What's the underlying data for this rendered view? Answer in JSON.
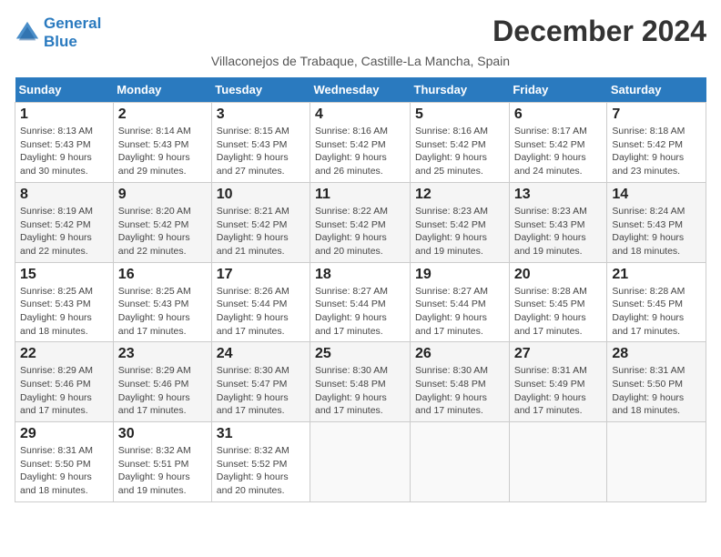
{
  "logo": {
    "line1": "General",
    "line2": "Blue"
  },
  "title": "December 2024",
  "subtitle": "Villaconejos de Trabaque, Castille-La Mancha, Spain",
  "days_of_week": [
    "Sunday",
    "Monday",
    "Tuesday",
    "Wednesday",
    "Thursday",
    "Friday",
    "Saturday"
  ],
  "weeks": [
    [
      {
        "day": "1",
        "detail": "Sunrise: 8:13 AM\nSunset: 5:43 PM\nDaylight: 9 hours\nand 30 minutes."
      },
      {
        "day": "2",
        "detail": "Sunrise: 8:14 AM\nSunset: 5:43 PM\nDaylight: 9 hours\nand 29 minutes."
      },
      {
        "day": "3",
        "detail": "Sunrise: 8:15 AM\nSunset: 5:43 PM\nDaylight: 9 hours\nand 27 minutes."
      },
      {
        "day": "4",
        "detail": "Sunrise: 8:16 AM\nSunset: 5:42 PM\nDaylight: 9 hours\nand 26 minutes."
      },
      {
        "day": "5",
        "detail": "Sunrise: 8:16 AM\nSunset: 5:42 PM\nDaylight: 9 hours\nand 25 minutes."
      },
      {
        "day": "6",
        "detail": "Sunrise: 8:17 AM\nSunset: 5:42 PM\nDaylight: 9 hours\nand 24 minutes."
      },
      {
        "day": "7",
        "detail": "Sunrise: 8:18 AM\nSunset: 5:42 PM\nDaylight: 9 hours\nand 23 minutes."
      }
    ],
    [
      {
        "day": "8",
        "detail": "Sunrise: 8:19 AM\nSunset: 5:42 PM\nDaylight: 9 hours\nand 22 minutes."
      },
      {
        "day": "9",
        "detail": "Sunrise: 8:20 AM\nSunset: 5:42 PM\nDaylight: 9 hours\nand 22 minutes."
      },
      {
        "day": "10",
        "detail": "Sunrise: 8:21 AM\nSunset: 5:42 PM\nDaylight: 9 hours\nand 21 minutes."
      },
      {
        "day": "11",
        "detail": "Sunrise: 8:22 AM\nSunset: 5:42 PM\nDaylight: 9 hours\nand 20 minutes."
      },
      {
        "day": "12",
        "detail": "Sunrise: 8:23 AM\nSunset: 5:42 PM\nDaylight: 9 hours\nand 19 minutes."
      },
      {
        "day": "13",
        "detail": "Sunrise: 8:23 AM\nSunset: 5:43 PM\nDaylight: 9 hours\nand 19 minutes."
      },
      {
        "day": "14",
        "detail": "Sunrise: 8:24 AM\nSunset: 5:43 PM\nDaylight: 9 hours\nand 18 minutes."
      }
    ],
    [
      {
        "day": "15",
        "detail": "Sunrise: 8:25 AM\nSunset: 5:43 PM\nDaylight: 9 hours\nand 18 minutes."
      },
      {
        "day": "16",
        "detail": "Sunrise: 8:25 AM\nSunset: 5:43 PM\nDaylight: 9 hours\nand 17 minutes."
      },
      {
        "day": "17",
        "detail": "Sunrise: 8:26 AM\nSunset: 5:44 PM\nDaylight: 9 hours\nand 17 minutes."
      },
      {
        "day": "18",
        "detail": "Sunrise: 8:27 AM\nSunset: 5:44 PM\nDaylight: 9 hours\nand 17 minutes."
      },
      {
        "day": "19",
        "detail": "Sunrise: 8:27 AM\nSunset: 5:44 PM\nDaylight: 9 hours\nand 17 minutes."
      },
      {
        "day": "20",
        "detail": "Sunrise: 8:28 AM\nSunset: 5:45 PM\nDaylight: 9 hours\nand 17 minutes."
      },
      {
        "day": "21",
        "detail": "Sunrise: 8:28 AM\nSunset: 5:45 PM\nDaylight: 9 hours\nand 17 minutes."
      }
    ],
    [
      {
        "day": "22",
        "detail": "Sunrise: 8:29 AM\nSunset: 5:46 PM\nDaylight: 9 hours\nand 17 minutes."
      },
      {
        "day": "23",
        "detail": "Sunrise: 8:29 AM\nSunset: 5:46 PM\nDaylight: 9 hours\nand 17 minutes."
      },
      {
        "day": "24",
        "detail": "Sunrise: 8:30 AM\nSunset: 5:47 PM\nDaylight: 9 hours\nand 17 minutes."
      },
      {
        "day": "25",
        "detail": "Sunrise: 8:30 AM\nSunset: 5:48 PM\nDaylight: 9 hours\nand 17 minutes."
      },
      {
        "day": "26",
        "detail": "Sunrise: 8:30 AM\nSunset: 5:48 PM\nDaylight: 9 hours\nand 17 minutes."
      },
      {
        "day": "27",
        "detail": "Sunrise: 8:31 AM\nSunset: 5:49 PM\nDaylight: 9 hours\nand 17 minutes."
      },
      {
        "day": "28",
        "detail": "Sunrise: 8:31 AM\nSunset: 5:50 PM\nDaylight: 9 hours\nand 18 minutes."
      }
    ],
    [
      {
        "day": "29",
        "detail": "Sunrise: 8:31 AM\nSunset: 5:50 PM\nDaylight: 9 hours\nand 18 minutes."
      },
      {
        "day": "30",
        "detail": "Sunrise: 8:32 AM\nSunset: 5:51 PM\nDaylight: 9 hours\nand 19 minutes."
      },
      {
        "day": "31",
        "detail": "Sunrise: 8:32 AM\nSunset: 5:52 PM\nDaylight: 9 hours\nand 20 minutes."
      },
      null,
      null,
      null,
      null
    ]
  ]
}
